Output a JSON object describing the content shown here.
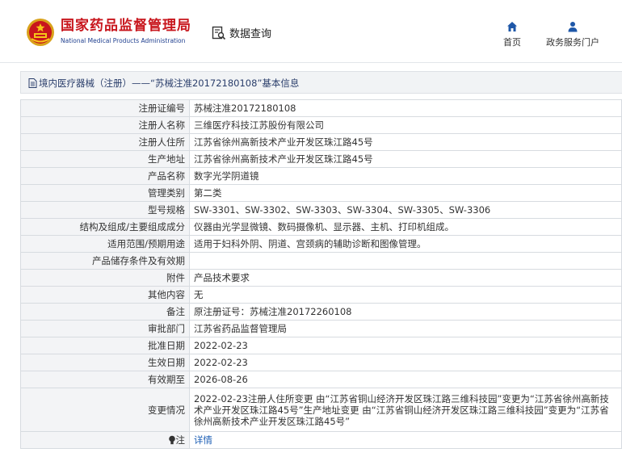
{
  "header": {
    "title_cn": "国家药品监督管理局",
    "title_en": "National Medical Products Administration",
    "data_query_label": "数据查询",
    "nav": {
      "home_label": "首页",
      "portal_label": "政务服务门户"
    }
  },
  "breadcrumb": {
    "text": "境内医疗器械（注册）——“苏械注准20172180108”基本信息"
  },
  "colors": {
    "brand_red": "#c8161d",
    "brand_blue": "#1f3f8f",
    "nav_icon": "#1e57a8",
    "link": "#1d5fb5"
  },
  "record": {
    "rows": [
      {
        "label": "注册证编号",
        "value": "苏械注准20172180108"
      },
      {
        "label": "注册人名称",
        "value": "三维医疗科技江苏股份有限公司"
      },
      {
        "label": "注册人住所",
        "value": "江苏省徐州高新技术产业开发区珠江路45号"
      },
      {
        "label": "生产地址",
        "value": "江苏省徐州高新技术产业开发区珠江路45号"
      },
      {
        "label": "产品名称",
        "value": "数字光学阴道镜"
      },
      {
        "label": "管理类别",
        "value": "第二类"
      },
      {
        "label": "型号规格",
        "value": "SW-3301、SW-3302、SW-3303、SW-3304、SW-3305、SW-3306"
      },
      {
        "label": "结构及组成/主要组成成分",
        "value": "仪器由光学显微镜、数码摄像机、显示器、主机、打印机组成。"
      },
      {
        "label": "适用范围/预期用途",
        "value": "适用于妇科外阴、阴道、宫颈病的辅助诊断和图像管理。"
      },
      {
        "label": "产品储存条件及有效期",
        "value": ""
      },
      {
        "label": "附件",
        "value": "产品技术要求"
      },
      {
        "label": "其他内容",
        "value": "无"
      },
      {
        "label": "备注",
        "value": "原注册证号：苏械注准20172260108"
      },
      {
        "label": "审批部门",
        "value": "江苏省药品监督管理局"
      },
      {
        "label": "批准日期",
        "value": "2022-02-23"
      },
      {
        "label": "生效日期",
        "value": "2022-02-23"
      },
      {
        "label": "有效期至",
        "value": "2026-08-26"
      },
      {
        "label": "变更情况",
        "value": "2022-02-23注册人住所变更 由“江苏省铜山经济开发区珠江路三维科技园”变更为“江苏省徐州高新技术产业开发区珠江路45号”生产地址变更 由“江苏省铜山经济开发区珠江路三维科技园”变更为“江苏省徐州高新技术产业开发区珠江路45号”"
      }
    ],
    "note": {
      "label": "注",
      "link_text": "详情"
    }
  }
}
